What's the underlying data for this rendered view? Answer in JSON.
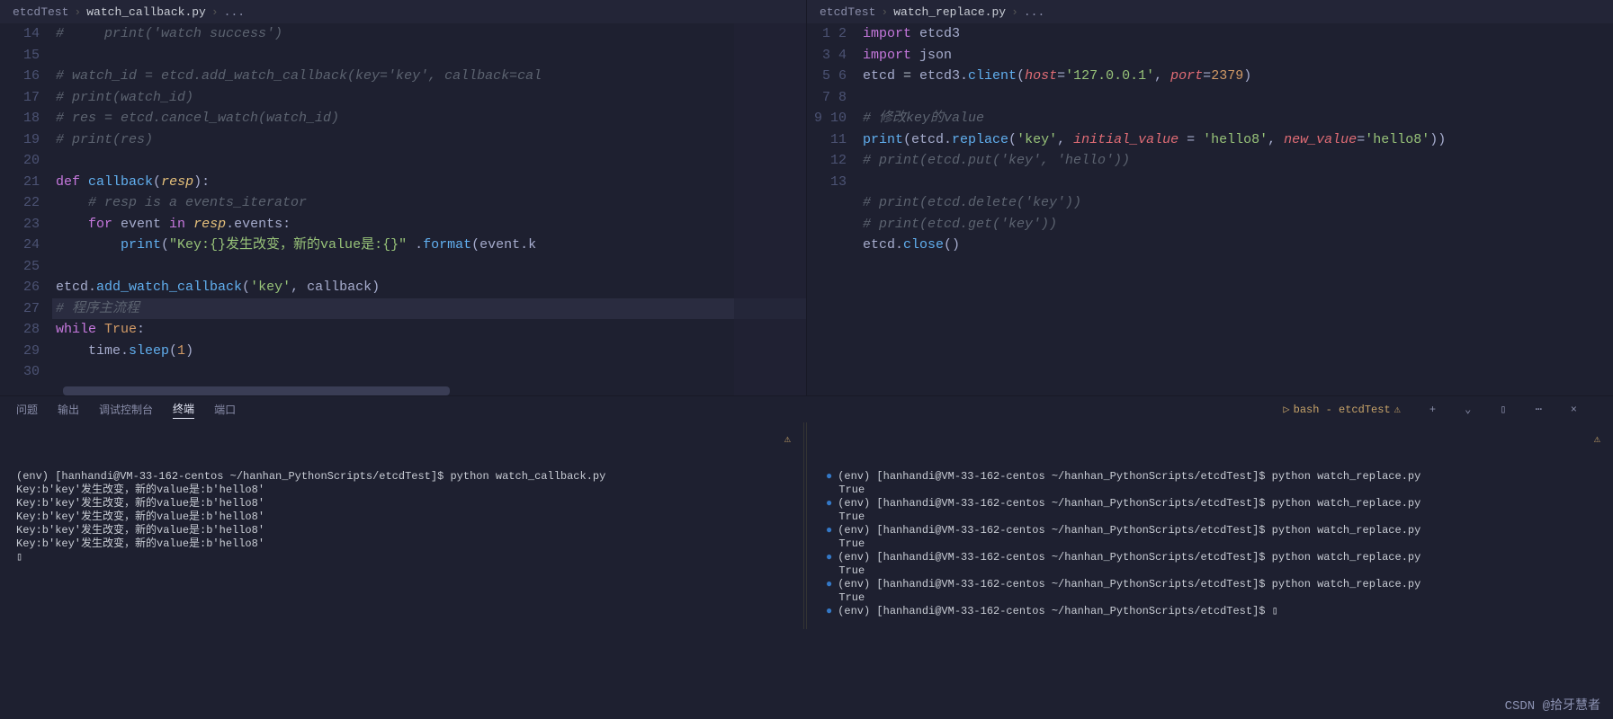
{
  "left": {
    "breadcrumb": [
      "etcdTest",
      "watch_callback.py",
      "..."
    ],
    "lines": [
      {
        "n": 14,
        "html": "<span class='tok-cmt'>#     print('watch success')</span>"
      },
      {
        "n": 15,
        "html": ""
      },
      {
        "n": 16,
        "html": "<span class='tok-cmt'># watch_id = etcd.add_watch_callback(key='key', callback=cal</span>"
      },
      {
        "n": 17,
        "html": "<span class='tok-cmt'># print(watch_id)</span>"
      },
      {
        "n": 18,
        "html": "<span class='tok-cmt'># res = etcd.cancel_watch(watch_id)</span>"
      },
      {
        "n": 19,
        "html": "<span class='tok-cmt'># print(res)</span>"
      },
      {
        "n": 20,
        "html": ""
      },
      {
        "n": 21,
        "html": "<span class='tok-def'>def</span> <span class='tok-fn'>callback</span>(<span class='tok-param'>resp</span>):"
      },
      {
        "n": 22,
        "html": "    <span class='tok-cmt'># resp is a events_iterator</span>"
      },
      {
        "n": 23,
        "html": "    <span class='tok-kw'>for</span> event <span class='tok-kw'>in</span> <span class='tok-param'>resp</span>.events:"
      },
      {
        "n": 24,
        "html": "        <span class='tok-fn'>print</span>(<span class='tok-str'>\"Key:{}发生改变，新的value是:{}\"</span> .<span class='tok-fn'>format</span>(event.k"
      },
      {
        "n": 25,
        "html": ""
      },
      {
        "n": 26,
        "html": "etcd.<span class='tok-fn'>add_watch_callback</span>(<span class='tok-str'>'key'</span>, callback)"
      },
      {
        "n": 27,
        "html": "<span class='hl-line'><span class='tok-cmt'># 程序主流程</span></span>"
      },
      {
        "n": 28,
        "html": "<span class='tok-kw'>while</span> <span class='tok-bool'>True</span>:"
      },
      {
        "n": 29,
        "html": "    time.<span class='tok-fn'>sleep</span>(<span class='tok-num'>1</span>)"
      },
      {
        "n": 30,
        "html": ""
      }
    ]
  },
  "right": {
    "breadcrumb": [
      "etcdTest",
      "watch_replace.py",
      "..."
    ],
    "lines": [
      {
        "n": 1,
        "html": "<span class='tok-kw'>import</span> etcd3"
      },
      {
        "n": 2,
        "html": "<span class='tok-kw'>import</span> json"
      },
      {
        "n": 3,
        "html": "etcd <span class='tok-op'>=</span> etcd3.<span class='tok-fn'>client</span>(<span class='tok-kwarg'>host</span>=<span class='tok-str'>'127.0.0.1'</span>, <span class='tok-kwarg'>port</span>=<span class='tok-num'>2379</span>)"
      },
      {
        "n": 4,
        "html": ""
      },
      {
        "n": 5,
        "html": "<span class='tok-cmt'># 修改key的value</span>"
      },
      {
        "n": 6,
        "html": "<span class='tok-fn'>print</span>(etcd.<span class='tok-fn'>replace</span>(<span class='tok-str'>'key'</span>, <span class='tok-kwarg'>initial_value</span> = <span class='tok-str'>'hello8'</span>, <span class='tok-kwarg'>new_value</span>=<span class='tok-str'>'hello8'</span>))"
      },
      {
        "n": 7,
        "html": "<span class='tok-cmt'># print(etcd.put('key', 'hello'))</span>"
      },
      {
        "n": 8,
        "html": ""
      },
      {
        "n": 9,
        "html": "<span class='tok-cmt'># print(etcd.delete('key'))</span>"
      },
      {
        "n": 10,
        "html": "<span class='tok-cmt'># print(etcd.get('key'))</span>"
      },
      {
        "n": 11,
        "html": "etcd.<span class='tok-fn'>close</span>()"
      },
      {
        "n": 12,
        "html": ""
      },
      {
        "n": 13,
        "html": ""
      }
    ]
  },
  "panel": {
    "tabs": [
      "问题",
      "输出",
      "调试控制台",
      "终端",
      "端口"
    ],
    "active": "终端",
    "shell_label": "bash - etcdTest",
    "icons": {
      "warn": "⚠",
      "add": "+",
      "split": "▯",
      "more": "⋯",
      "close": "×"
    }
  },
  "terminal_left": [
    "(env) [hanhandi@VM-33-162-centos ~/hanhan_PythonScripts/etcdTest]$ python watch_callback.py",
    "Key:b'key'发生改变，新的value是:b'hello8'",
    "Key:b'key'发生改变，新的value是:b'hello8'",
    "Key:b'key'发生改变，新的value是:b'hello8'",
    "Key:b'key'发生改变，新的value是:b'hello8'",
    "Key:b'key'发生改变，新的value是:b'hello8'",
    "▯"
  ],
  "terminal_right": [
    {
      "dot": true,
      "t": "(env) [hanhandi@VM-33-162-centos ~/hanhan_PythonScripts/etcdTest]$ python watch_replace.py"
    },
    {
      "t": "True"
    },
    {
      "dot": true,
      "t": "(env) [hanhandi@VM-33-162-centos ~/hanhan_PythonScripts/etcdTest]$ python watch_replace.py"
    },
    {
      "t": "True"
    },
    {
      "dot": true,
      "t": "(env) [hanhandi@VM-33-162-centos ~/hanhan_PythonScripts/etcdTest]$ python watch_replace.py"
    },
    {
      "t": "True"
    },
    {
      "dot": true,
      "t": "(env) [hanhandi@VM-33-162-centos ~/hanhan_PythonScripts/etcdTest]$ python watch_replace.py"
    },
    {
      "t": "True"
    },
    {
      "dot": true,
      "t": "(env) [hanhandi@VM-33-162-centos ~/hanhan_PythonScripts/etcdTest]$ python watch_replace.py"
    },
    {
      "t": "True"
    },
    {
      "dot": true,
      "t": "(env) [hanhandi@VM-33-162-centos ~/hanhan_PythonScripts/etcdTest]$ ▯"
    }
  ],
  "watermark": "CSDN @拾牙慧者"
}
